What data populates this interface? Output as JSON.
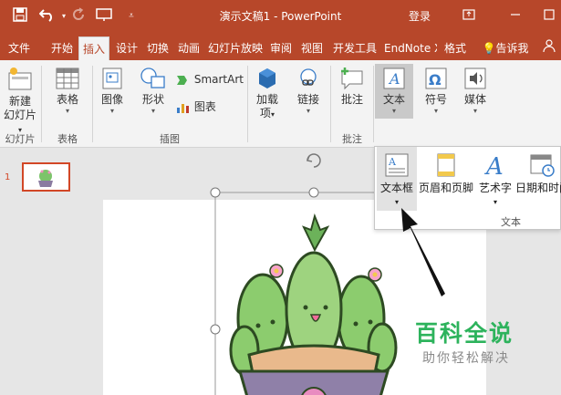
{
  "titlebar": {
    "title": "演示文稿1  -  PowerPoint",
    "login": "登录"
  },
  "tabs": [
    "文件",
    "开始",
    "插入",
    "设计",
    "切换",
    "动画",
    "幻灯片放映",
    "审阅",
    "视图",
    "开发工具",
    "EndNote X",
    "格式"
  ],
  "tell_me": "告诉我",
  "ribbon": {
    "new_slide_line1": "新建",
    "new_slide_line2": "幻灯片",
    "table": "表格",
    "image": "图像",
    "shapes": "形状",
    "smartart": "SmartArt",
    "chart": "图表",
    "addins_line1": "加载",
    "addins_line2": "项",
    "link": "链接",
    "comment": "批注",
    "text": "文本",
    "symbol": "符号",
    "media": "媒体",
    "groups": {
      "slides": "幻灯片",
      "tables": "表格",
      "illustrations": "插图",
      "comments": "批注"
    }
  },
  "dropdown": {
    "textbox": "文本框",
    "header_footer": "页眉和页脚",
    "wordart": "艺术字",
    "datetime": "日期和时间",
    "group": "文本"
  },
  "slide_number": "1",
  "watermark": {
    "title": "百科全说",
    "subtitle": "助你轻松解决"
  },
  "colors": {
    "accent": "#b7472a",
    "watermark_green": "#2db35c"
  }
}
